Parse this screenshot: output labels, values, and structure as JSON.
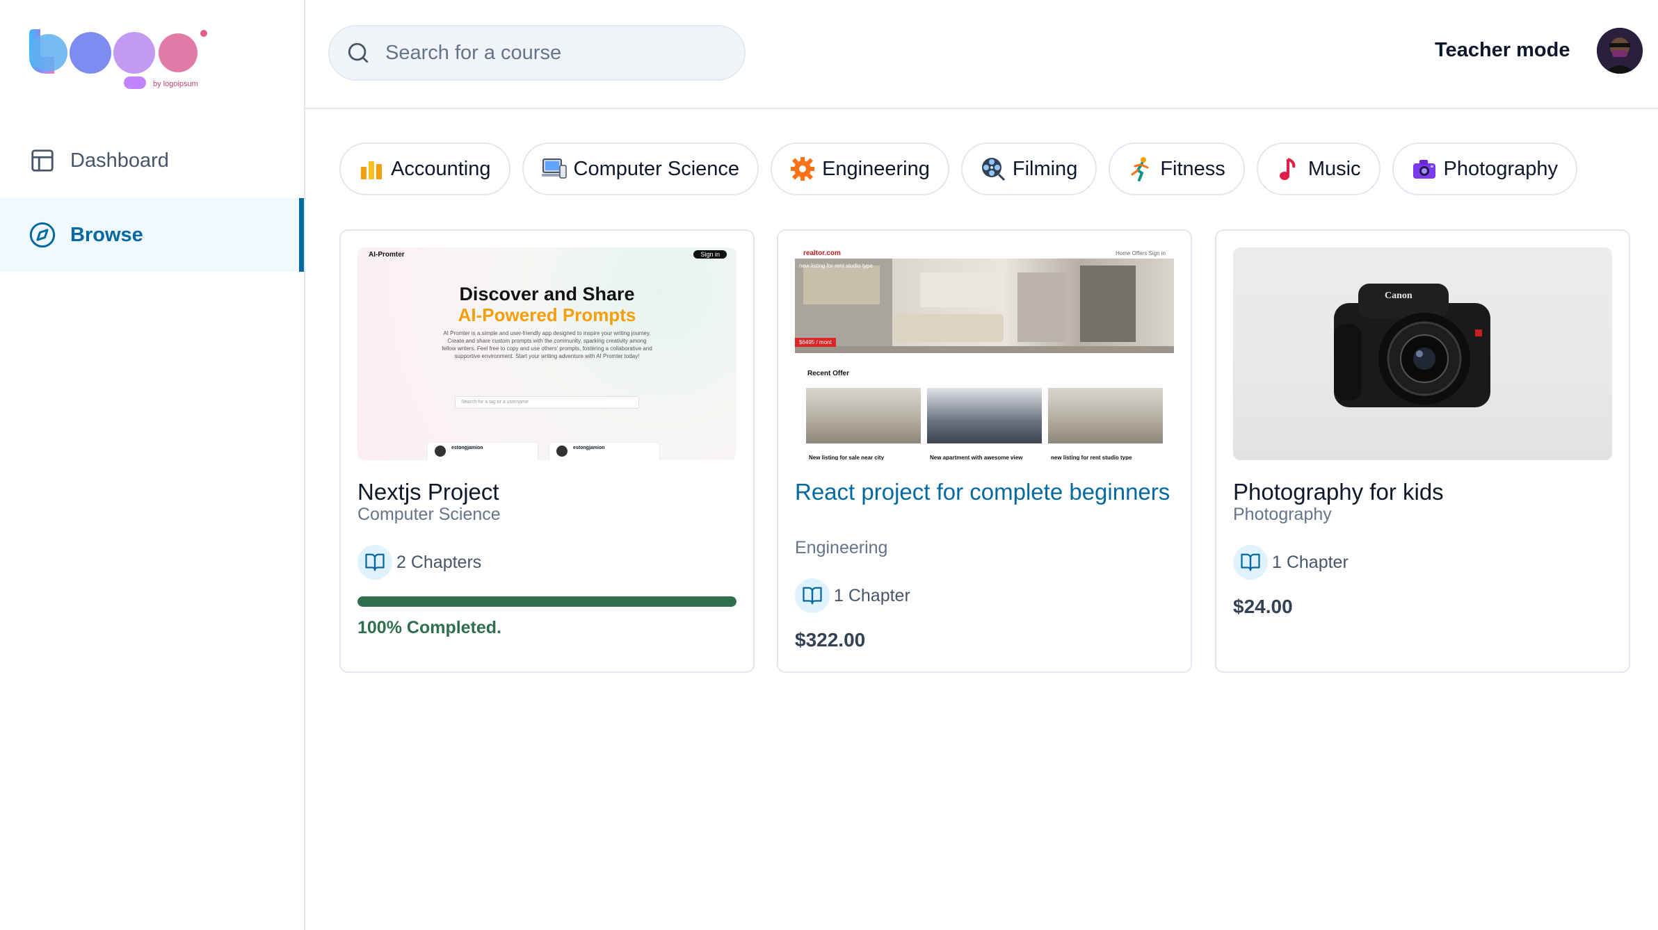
{
  "logo": {
    "brand_text": "by logoipsum"
  },
  "sidebar": {
    "items": [
      {
        "label": "Dashboard",
        "icon": "layout-icon",
        "active": false
      },
      {
        "label": "Browse",
        "icon": "compass-icon",
        "active": true
      }
    ]
  },
  "header": {
    "search_placeholder": "Search for a course",
    "teacher_mode_label": "Teacher mode"
  },
  "categories": [
    {
      "label": "Accounting",
      "icon": "bar-chart-emoji-icon"
    },
    {
      "label": "Computer Science",
      "icon": "computer-emoji-icon"
    },
    {
      "label": "Engineering",
      "icon": "gear-emoji-icon"
    },
    {
      "label": "Filming",
      "icon": "film-reel-emoji-icon"
    },
    {
      "label": "Fitness",
      "icon": "runner-emoji-icon"
    },
    {
      "label": "Music",
      "icon": "music-note-emoji-icon"
    },
    {
      "label": "Photography",
      "icon": "camera-emoji-icon"
    }
  ],
  "courses": [
    {
      "title": "Nextjs Project",
      "category": "Computer Science",
      "chapters": "2 Chapters",
      "progress": 100,
      "progress_text": "100% Completed.",
      "thumbnail": {
        "brand": "AI-Promter",
        "signin": "Sign in",
        "heading": "Discover and Share",
        "highlight": "AI-Powered Prompts",
        "body": "AI Promter is a simple and user-friendly app designed to inspire your writing journey. Create and share custom prompts with the community, sparking creativity among fellow writers. Feel free to copy and use others' prompts, fostering a collaborative and supportive environment. Start your writing adventure with AI Promter today!",
        "search_hint": "Search for a tag or a username",
        "user_a": "estongjamion",
        "user_b": "estongjamion"
      }
    },
    {
      "title": "React project for complete beginners",
      "category": "Engineering",
      "chapters": "1 Chapter",
      "price": "$322.00",
      "thumbnail": {
        "brand": "realtor.com",
        "nav": "Home   Offers   Sign in",
        "hero_label": "new listing for rent studio type",
        "price_tag": "$6495 / mont",
        "recent_title": "Recent Offer",
        "captions": [
          "New listing for sale near city",
          "New apartment with awesome view",
          "new listing for rent studio type"
        ]
      }
    },
    {
      "title": "Photography for kids",
      "category": "Photography",
      "chapters": "1 Chapter",
      "price": "$24.00",
      "thumbnail": {
        "camera_brand": "Canon"
      }
    }
  ],
  "colors": {
    "accent": "#0369a1",
    "progress": "#2f6f4e",
    "active_bg": "#f0f9ff"
  }
}
